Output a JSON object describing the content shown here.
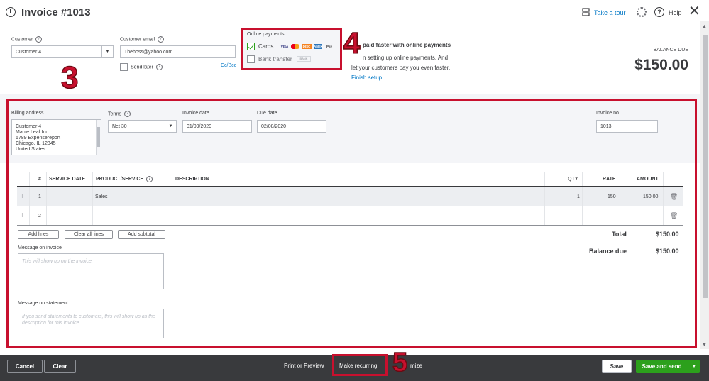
{
  "header": {
    "title": "Invoice #1013",
    "take_tour": "Take a tour",
    "help": "Help",
    "close": "✕"
  },
  "customer": {
    "label": "Customer",
    "value": "Customer 4",
    "email_label": "Customer email",
    "email_value": "Theboss@yahoo.com",
    "send_later": "Send later",
    "cc_bcc": "Cc/Bcc"
  },
  "online_payments": {
    "title": "Online payments",
    "cards_label": "Cards",
    "cards_checked": true,
    "card_logos": [
      "VISA",
      "MC",
      "DISC",
      "AMEX",
      "Pay"
    ],
    "bank_label": "Bank transfer",
    "bank_logo": "BANK",
    "bank_checked": false
  },
  "promo": {
    "headline": "paid faster with online payments",
    "line1": "n setting up online payments. And",
    "line2": "let your customers pay you even faster.",
    "finish_setup": "Finish setup"
  },
  "balance": {
    "label": "BALANCE DUE",
    "amount": "$150.00"
  },
  "annotations": {
    "three": "3",
    "four": "4",
    "five": "5"
  },
  "billing": {
    "label": "Billing address",
    "lines": [
      "Customer 4",
      "Maple Leaf Inc.",
      "6789 Expensereport",
      "Chicago, IL  12345",
      "United States"
    ],
    "terms_label": "Terms",
    "terms_value": "Net 30",
    "invoice_date_label": "Invoice date",
    "invoice_date": "01/09/2020",
    "due_date_label": "Due date",
    "due_date": "02/08/2020",
    "invoice_no_label": "Invoice no.",
    "invoice_no": "1013"
  },
  "table": {
    "headers": {
      "num": "#",
      "service_date": "SERVICE DATE",
      "product": "PRODUCT/SERVICE",
      "description": "DESCRIPTION",
      "qty": "QTY",
      "rate": "RATE",
      "amount": "AMOUNT"
    },
    "rows": [
      {
        "num": "1",
        "service_date": "",
        "product": "Sales",
        "description": "",
        "qty": "1",
        "rate": "150",
        "amount": "150.00"
      },
      {
        "num": "2",
        "service_date": "",
        "product": "",
        "description": "",
        "qty": "",
        "rate": "",
        "amount": ""
      }
    ]
  },
  "line_buttons": {
    "add_lines": "Add lines",
    "clear_all": "Clear all lines",
    "add_subtotal": "Add subtotal"
  },
  "totals": {
    "total_label": "Total",
    "total": "$150.00",
    "balance_due_label": "Balance due",
    "balance_due": "$150.00"
  },
  "messages": {
    "invoice_label": "Message on invoice",
    "invoice_placeholder": "This will show up on the invoice.",
    "statement_label": "Message on statement",
    "statement_placeholder": "If you send statements to customers, this will show up as the description for this invoice."
  },
  "footer": {
    "cancel": "Cancel",
    "clear": "Clear",
    "print_preview": "Print or Preview",
    "make_recurring": "Make recurring",
    "customize": "mize",
    "save": "Save",
    "save_and_send": "Save and send"
  }
}
